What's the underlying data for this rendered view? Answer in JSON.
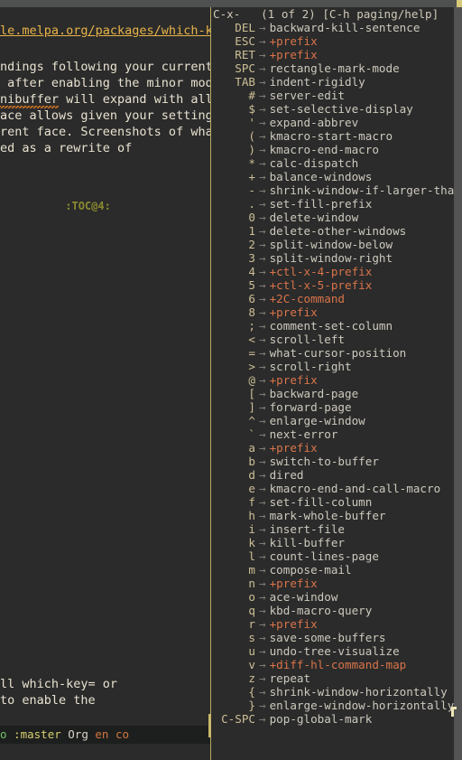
{
  "window": {
    "top_bar_color": "#4f5050",
    "background": "#2b2b2b",
    "divider_color": "#b9ab63"
  },
  "left_buffer": {
    "name": "org-readme-buffer",
    "lines": [
      {
        "kind": "url",
        "text": "le.melpa.org/packages/which-key-b"
      },
      {
        "kind": "blank",
        "text": ""
      },
      {
        "kind": "text",
        "text": "ndings following your currently"
      },
      {
        "kind": "text",
        "text": " after enabling the minor mode"
      },
      {
        "kind": "spell",
        "spell_word": "nibuffer",
        "rest": " will expand with all of"
      },
      {
        "kind": "text",
        "text": "ace allows given your settings)."
      },
      {
        "kind": "text",
        "text": "rent face. Screenshots of what"
      },
      {
        "kind": "text",
        "text": "ed as a rewrite of"
      },
      {
        "kind": "blank",
        "text": ""
      },
      {
        "kind": "blank",
        "text": ""
      },
      {
        "kind": "toc",
        "text": ":TOC@4:"
      }
    ],
    "tail_lines": [
      {
        "kind": "text",
        "text": "ll which-key= or"
      },
      {
        "kind": "text",
        "text": "to enable the"
      }
    ]
  },
  "left_modeline": {
    "segments": [
      {
        "text": "o",
        "color": "#74c16a"
      },
      {
        "text": " ",
        "color": "#d9d4c6"
      },
      {
        "text": ":master",
        "color": "#d8cf6f"
      },
      {
        "text": " ",
        "color": "#d9d4c6"
      },
      {
        "text": "Org",
        "color": "#d9d4c6"
      },
      {
        "text": " ",
        "color": "#d9d4c6"
      },
      {
        "text": "en",
        "color": "#d2773f"
      },
      {
        "text": " ",
        "color": "#d9d4c6"
      },
      {
        "text": "co",
        "color": "#d2773f"
      }
    ]
  },
  "which_key": {
    "header": "C-x-   (1 of 2) [C-h paging/help]",
    "arrow": "→",
    "colors": {
      "key": "#cdbf96",
      "arrow": "#7e7b72",
      "command": "#cdc9bd",
      "prefix": "#d9744a"
    },
    "bindings": [
      {
        "key": "DEL",
        "cmd": "backward-kill-sentence",
        "prefix": false
      },
      {
        "key": "ESC",
        "cmd": "+prefix",
        "prefix": true
      },
      {
        "key": "RET",
        "cmd": "+prefix",
        "prefix": true
      },
      {
        "key": "SPC",
        "cmd": "rectangle-mark-mode",
        "prefix": false
      },
      {
        "key": "TAB",
        "cmd": "indent-rigidly",
        "prefix": false
      },
      {
        "key": "#",
        "cmd": "server-edit",
        "prefix": false
      },
      {
        "key": "$",
        "cmd": "set-selective-display",
        "prefix": false
      },
      {
        "key": "'",
        "cmd": "expand-abbrev",
        "prefix": false
      },
      {
        "key": "(",
        "cmd": "kmacro-start-macro",
        "prefix": false
      },
      {
        "key": ")",
        "cmd": "kmacro-end-macro",
        "prefix": false
      },
      {
        "key": "*",
        "cmd": "calc-dispatch",
        "prefix": false
      },
      {
        "key": "+",
        "cmd": "balance-windows",
        "prefix": false
      },
      {
        "key": "-",
        "cmd": "shrink-window-if-larger-tha..",
        "prefix": false
      },
      {
        "key": ".",
        "cmd": "set-fill-prefix",
        "prefix": false
      },
      {
        "key": "0",
        "cmd": "delete-window",
        "prefix": false
      },
      {
        "key": "1",
        "cmd": "delete-other-windows",
        "prefix": false
      },
      {
        "key": "2",
        "cmd": "split-window-below",
        "prefix": false
      },
      {
        "key": "3",
        "cmd": "split-window-right",
        "prefix": false
      },
      {
        "key": "4",
        "cmd": "+ctl-x-4-prefix",
        "prefix": true
      },
      {
        "key": "5",
        "cmd": "+ctl-x-5-prefix",
        "prefix": true
      },
      {
        "key": "6",
        "cmd": "+2C-command",
        "prefix": true
      },
      {
        "key": "8",
        "cmd": "+prefix",
        "prefix": true
      },
      {
        "key": ";",
        "cmd": "comment-set-column",
        "prefix": false
      },
      {
        "key": "<",
        "cmd": "scroll-left",
        "prefix": false
      },
      {
        "key": "=",
        "cmd": "what-cursor-position",
        "prefix": false
      },
      {
        "key": ">",
        "cmd": "scroll-right",
        "prefix": false
      },
      {
        "key": "@",
        "cmd": "+prefix",
        "prefix": true
      },
      {
        "key": "[",
        "cmd": "backward-page",
        "prefix": false
      },
      {
        "key": "]",
        "cmd": "forward-page",
        "prefix": false
      },
      {
        "key": "^",
        "cmd": "enlarge-window",
        "prefix": false
      },
      {
        "key": "`",
        "cmd": "next-error",
        "prefix": false
      },
      {
        "key": "a",
        "cmd": "+prefix",
        "prefix": true
      },
      {
        "key": "b",
        "cmd": "switch-to-buffer",
        "prefix": false
      },
      {
        "key": "d",
        "cmd": "dired",
        "prefix": false
      },
      {
        "key": "e",
        "cmd": "kmacro-end-and-call-macro",
        "prefix": false
      },
      {
        "key": "f",
        "cmd": "set-fill-column",
        "prefix": false
      },
      {
        "key": "h",
        "cmd": "mark-whole-buffer",
        "prefix": false
      },
      {
        "key": "i",
        "cmd": "insert-file",
        "prefix": false
      },
      {
        "key": "k",
        "cmd": "kill-buffer",
        "prefix": false
      },
      {
        "key": "l",
        "cmd": "count-lines-page",
        "prefix": false
      },
      {
        "key": "m",
        "cmd": "compose-mail",
        "prefix": false
      },
      {
        "key": "n",
        "cmd": "+prefix",
        "prefix": true
      },
      {
        "key": "o",
        "cmd": "ace-window",
        "prefix": false
      },
      {
        "key": "q",
        "cmd": "kbd-macro-query",
        "prefix": false
      },
      {
        "key": "r",
        "cmd": "+prefix",
        "prefix": true
      },
      {
        "key": "s",
        "cmd": "save-some-buffers",
        "prefix": false
      },
      {
        "key": "u",
        "cmd": "undo-tree-visualize",
        "prefix": false
      },
      {
        "key": "v",
        "cmd": "+diff-hl-command-map",
        "prefix": true
      },
      {
        "key": "z",
        "cmd": "repeat",
        "prefix": false
      },
      {
        "key": "{",
        "cmd": "shrink-window-horizontally",
        "prefix": false
      },
      {
        "key": "}",
        "cmd": "enlarge-window-horizontally",
        "prefix": false
      },
      {
        "key": "C-SPC",
        "cmd": "pop-global-mark",
        "prefix": false
      }
    ]
  }
}
